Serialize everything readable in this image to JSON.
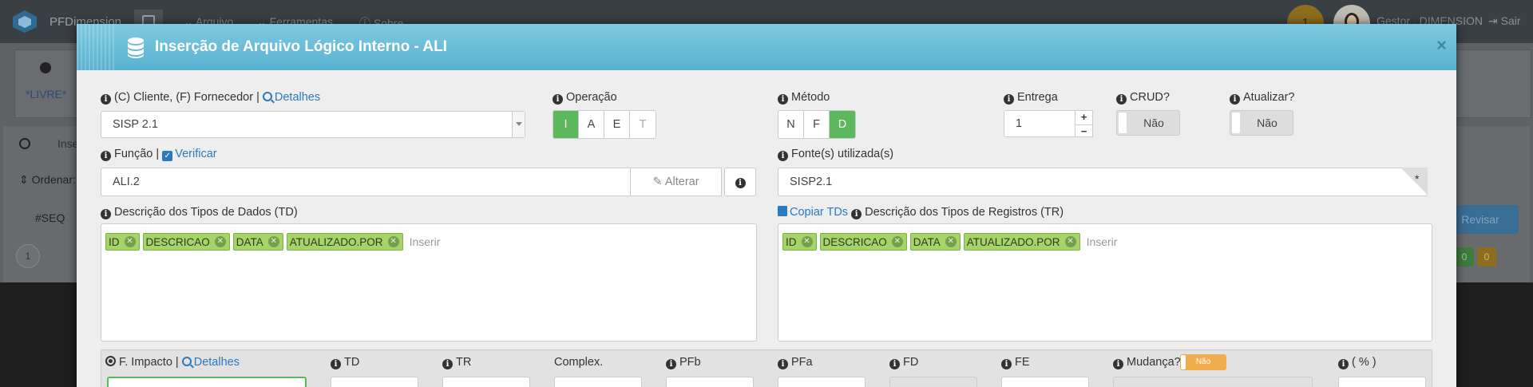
{
  "app": {
    "brand": "PFDimension",
    "nav": [
      "Arquivo",
      "Ferramentas",
      "Sobre"
    ],
    "notification_count": "1",
    "user": "Gestor . DIMENSION",
    "logout": "Sair"
  },
  "background": {
    "tab_label": "*LIVRE*",
    "ordenar": "Ordenar:",
    "seq_header": "#SEQ",
    "row_number": "1",
    "insert_partial": "Inse",
    "revisar": "Revisar",
    "badges": [
      "0",
      "0"
    ]
  },
  "modal": {
    "title": "Inserção de Arquivo Lógico Interno - ALI",
    "close": "×",
    "cliente_label": "(C) Cliente, (F) Fornecedor |",
    "detalhes": "Detalhes",
    "cliente_value": "SISP 2.1",
    "operacao_label": "Operação",
    "operacao_options": [
      "I",
      "A",
      "E",
      "T"
    ],
    "metodo_label": "Método",
    "metodo_options": [
      "N",
      "F",
      "D"
    ],
    "entrega_label": "Entrega",
    "entrega_value": "1",
    "crud_label": "CRUD?",
    "crud_value": "Não",
    "atualizar_label": "Atualizar?",
    "atualizar_value": "Não",
    "funcao_label": "Função |",
    "verificar": "Verificar",
    "funcao_value": "ALI.2",
    "alterar": "Alterar",
    "fonte_label": "Fonte(s) utilizada(s)",
    "fonte_value": "SISP2.1",
    "td_label": "Descrição dos Tipos de Dados (TD)",
    "td_tags": [
      "ID",
      "DESCRICAO",
      "DATA",
      "ATUALIZADO.POR"
    ],
    "copiar_tds": "Copiar TDs",
    "tr_label": "Descrição dos Tipos de Registros (TR)",
    "tr_tags": [
      "ID",
      "DESCRICAO",
      "DATA",
      "ATUALIZADO.POR"
    ],
    "tag_placeholder": "Inserir",
    "bottom": {
      "impacto": "F. Impacto |",
      "detalhes": "Detalhes",
      "td": "TD",
      "tr": "TR",
      "complex": "Complex.",
      "pfb": "PFb",
      "pfa": "PFa",
      "fd": "FD",
      "fe": "FE",
      "mudanca": "Mudança?",
      "mudanca_value": "Não",
      "percent": "( % )"
    }
  }
}
